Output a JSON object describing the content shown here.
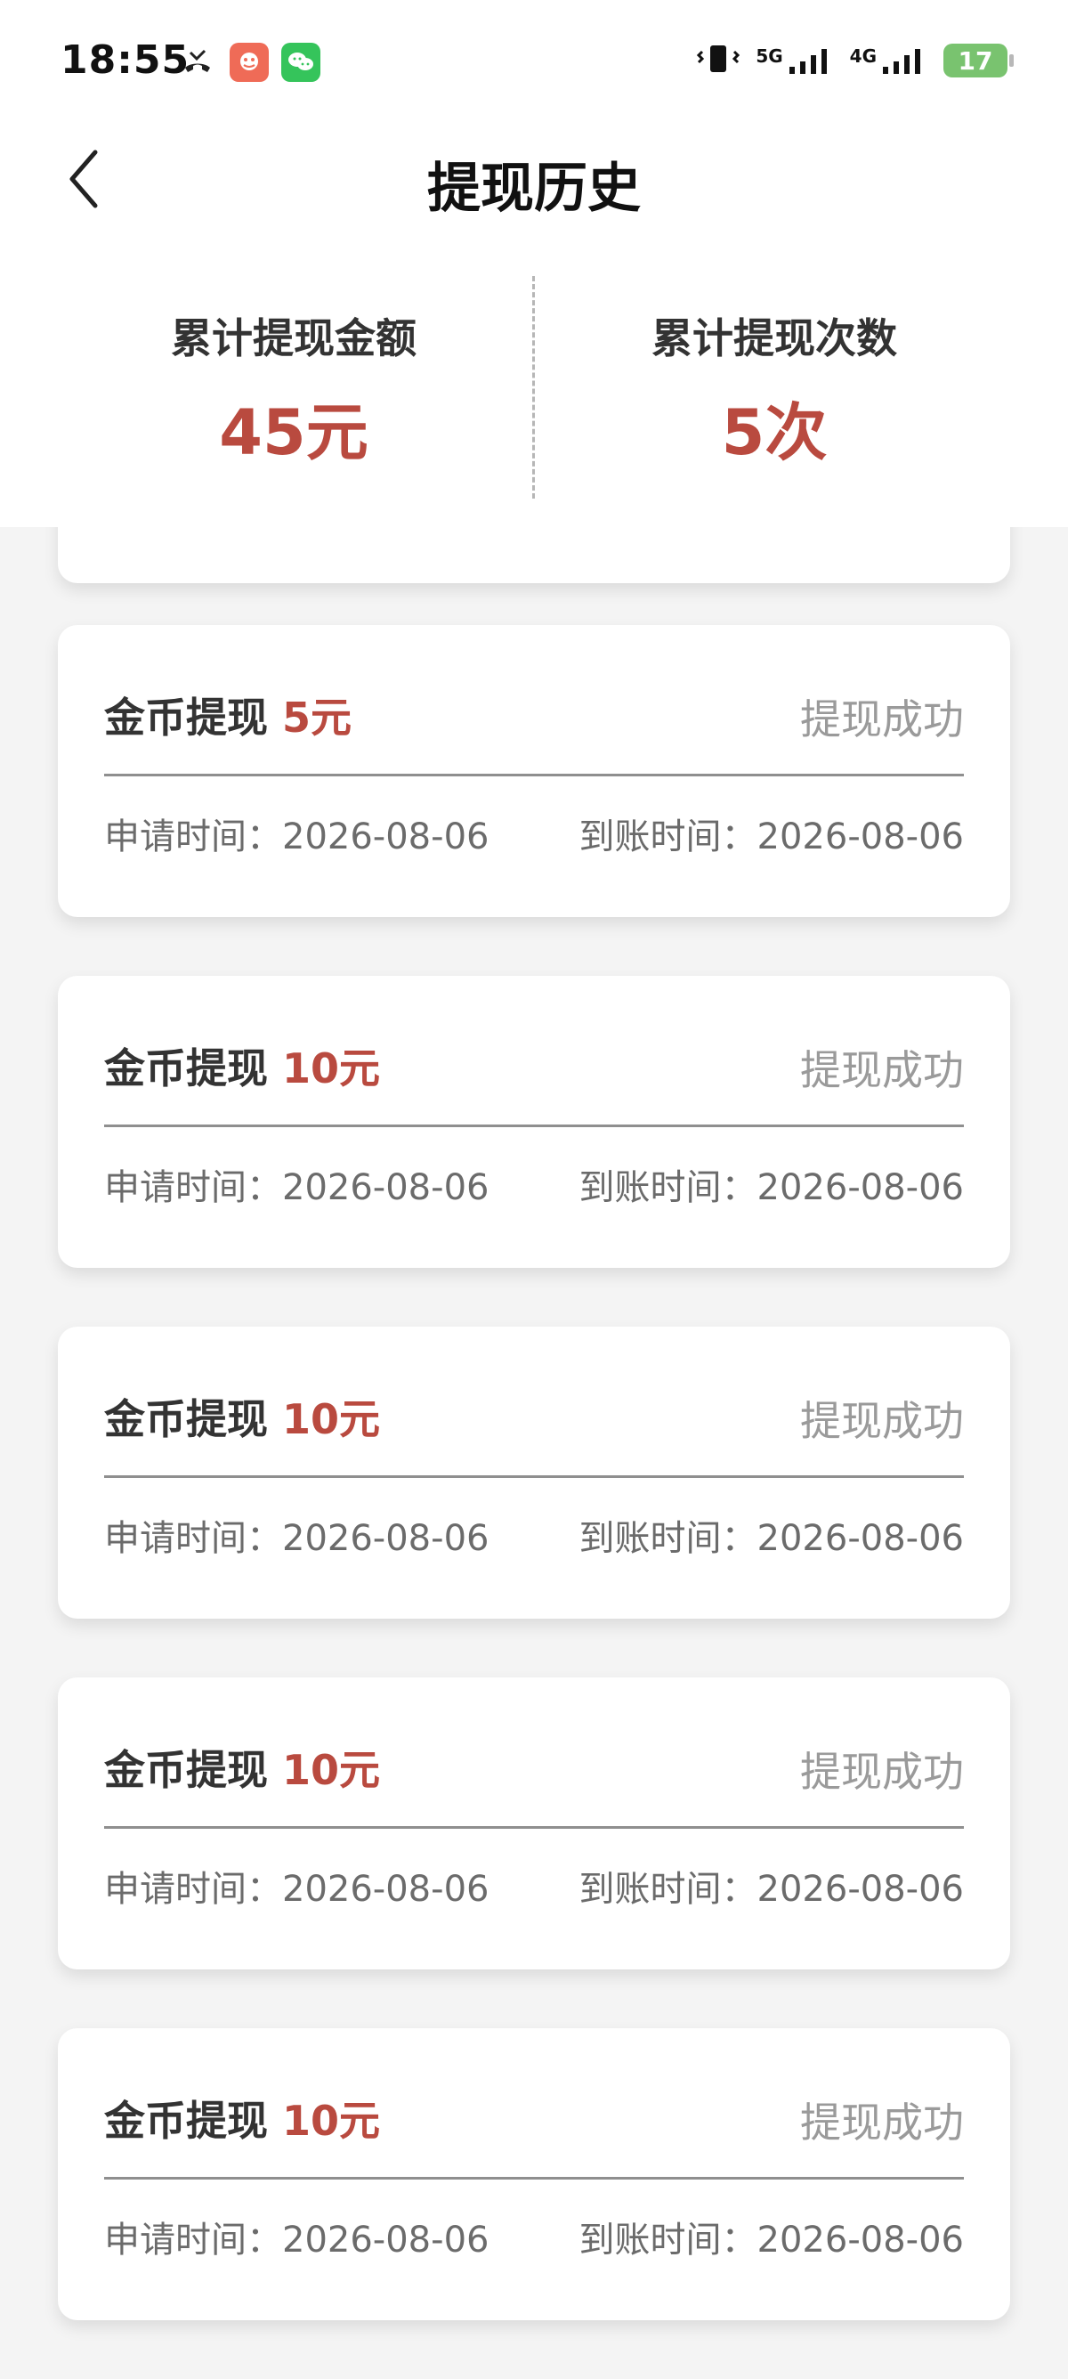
{
  "status_bar": {
    "time": "18:55",
    "network_5g": "5G",
    "network_4g": "4G",
    "battery": "17"
  },
  "header": {
    "title": "提现历史"
  },
  "summary": {
    "total_amount_label": "累计提现金额",
    "total_amount_value": "45元",
    "total_count_label": "累计提现次数",
    "total_count_value": "5次"
  },
  "records": [
    {
      "title": "金币提现",
      "amount": "5元",
      "status": "提现成功",
      "apply_label": "申请时间：",
      "apply_time": "2026-08-06",
      "arrive_label": "到账时间：",
      "arrive_time": "2026-08-06"
    },
    {
      "title": "金币提现",
      "amount": "10元",
      "status": "提现成功",
      "apply_label": "申请时间：",
      "apply_time": "2026-08-06",
      "arrive_label": "到账时间：",
      "arrive_time": "2026-08-06"
    },
    {
      "title": "金币提现",
      "amount": "10元",
      "status": "提现成功",
      "apply_label": "申请时间：",
      "apply_time": "2026-08-06",
      "arrive_label": "到账时间：",
      "arrive_time": "2026-08-06"
    },
    {
      "title": "金币提现",
      "amount": "10元",
      "status": "提现成功",
      "apply_label": "申请时间：",
      "apply_time": "2026-08-06",
      "arrive_label": "到账时间：",
      "arrive_time": "2026-08-06"
    },
    {
      "title": "金币提现",
      "amount": "10元",
      "status": "提现成功",
      "apply_label": "申请时间：",
      "apply_time": "2026-08-06",
      "arrive_label": "到账时间：",
      "arrive_time": "2026-08-06"
    }
  ],
  "colors": {
    "accent": "#b94a3f",
    "text": "#333333",
    "muted": "#9a9a9a",
    "background": "#f4f4f4"
  },
  "icons": {
    "back": "chevron-left-icon",
    "missed_call": "missed-call-icon",
    "app_notification": "app-notification-icon",
    "wechat": "wechat-icon",
    "vibrate": "vibrate-icon",
    "signal": "signal-icon",
    "battery": "battery-icon"
  }
}
